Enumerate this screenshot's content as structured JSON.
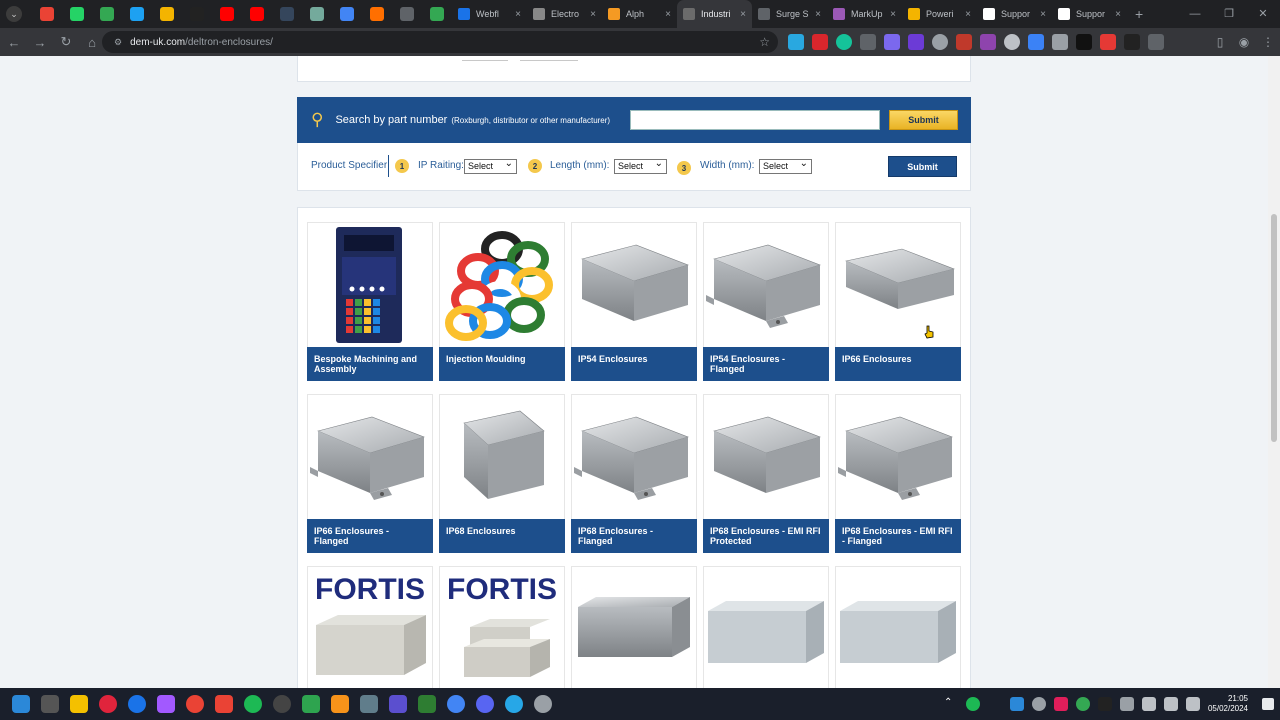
{
  "browser": {
    "tabs": [
      {
        "title": "Webfl",
        "color": "#1a73e8"
      },
      {
        "title": "Electro",
        "color": "#888888"
      },
      {
        "title": "Alph",
        "color": "#f59a23"
      },
      {
        "title": "Industri",
        "color": "#6b6b6b",
        "active": true
      },
      {
        "title": "Surge S",
        "color": "#5f6368"
      },
      {
        "title": "MarkUp",
        "color": "#9b59b6"
      },
      {
        "title": "Poweri",
        "color": "#f4b400"
      },
      {
        "title": "Suppor",
        "color": "#ffffff"
      },
      {
        "title": "Suppor",
        "color": "#ffffff"
      }
    ],
    "pinned_colors": [
      "#ea4335",
      "#25d366",
      "#34a853",
      "#1da1f2",
      "#f4b400",
      "#222222",
      "#ff0000",
      "#ff0000",
      "#35465c",
      "#74aa9c",
      "#4285f4",
      "#ff6f00",
      "#5f6368",
      "#34a853"
    ],
    "url_host": "dem-uk.com",
    "url_path": "/deltron-enclosures/",
    "tab_close": "×",
    "new_tab": "+"
  },
  "search": {
    "label": "Search by part number",
    "sublabel": "(Roxburgh, distributor or other manufacturer)",
    "submit": "Submit"
  },
  "specifier": {
    "title": "Product Specifier",
    "step1": "1",
    "ip_label": "IP Raiting:",
    "ip_value": "Select",
    "step2": "2",
    "length_label": "Length (mm):",
    "length_value": "Select",
    "step3": "3",
    "width_label": "Width (mm):",
    "width_value": "Select",
    "submit": "Submit"
  },
  "products": [
    {
      "name": "Bespoke Machining and Assembly",
      "image": "control-panel"
    },
    {
      "name": "Injection Moulding",
      "image": "rings"
    },
    {
      "name": "IP54 Enclosures",
      "image": "alu-box"
    },
    {
      "name": "IP54 Enclosures - Flanged",
      "image": "alu-box-flanged"
    },
    {
      "name": "IP66 Enclosures",
      "image": "alu-box-flat"
    },
    {
      "name": "IP66 Enclosures - Flanged",
      "image": "alu-box-flanged"
    },
    {
      "name": "IP68 Enclosures",
      "image": "alu-box-tall"
    },
    {
      "name": "IP68 Enclosures - Flanged",
      "image": "alu-box-flanged"
    },
    {
      "name": "IP68 Enclosures - EMI RFI Protected",
      "image": "alu-box"
    },
    {
      "name": "IP68 Enclosures - EMI RFI - Flanged",
      "image": "alu-box-flanged"
    },
    {
      "name": "",
      "image": "fortis-box",
      "logo": "FORTIS"
    },
    {
      "name": "",
      "image": "fortis-open",
      "logo": "FORTIS"
    },
    {
      "name": "",
      "image": "cast-box"
    },
    {
      "name": "",
      "image": "grey-box"
    },
    {
      "name": "",
      "image": "grey-box"
    }
  ],
  "taskbar": {
    "time": "21:05",
    "date": "05/02/2024"
  }
}
